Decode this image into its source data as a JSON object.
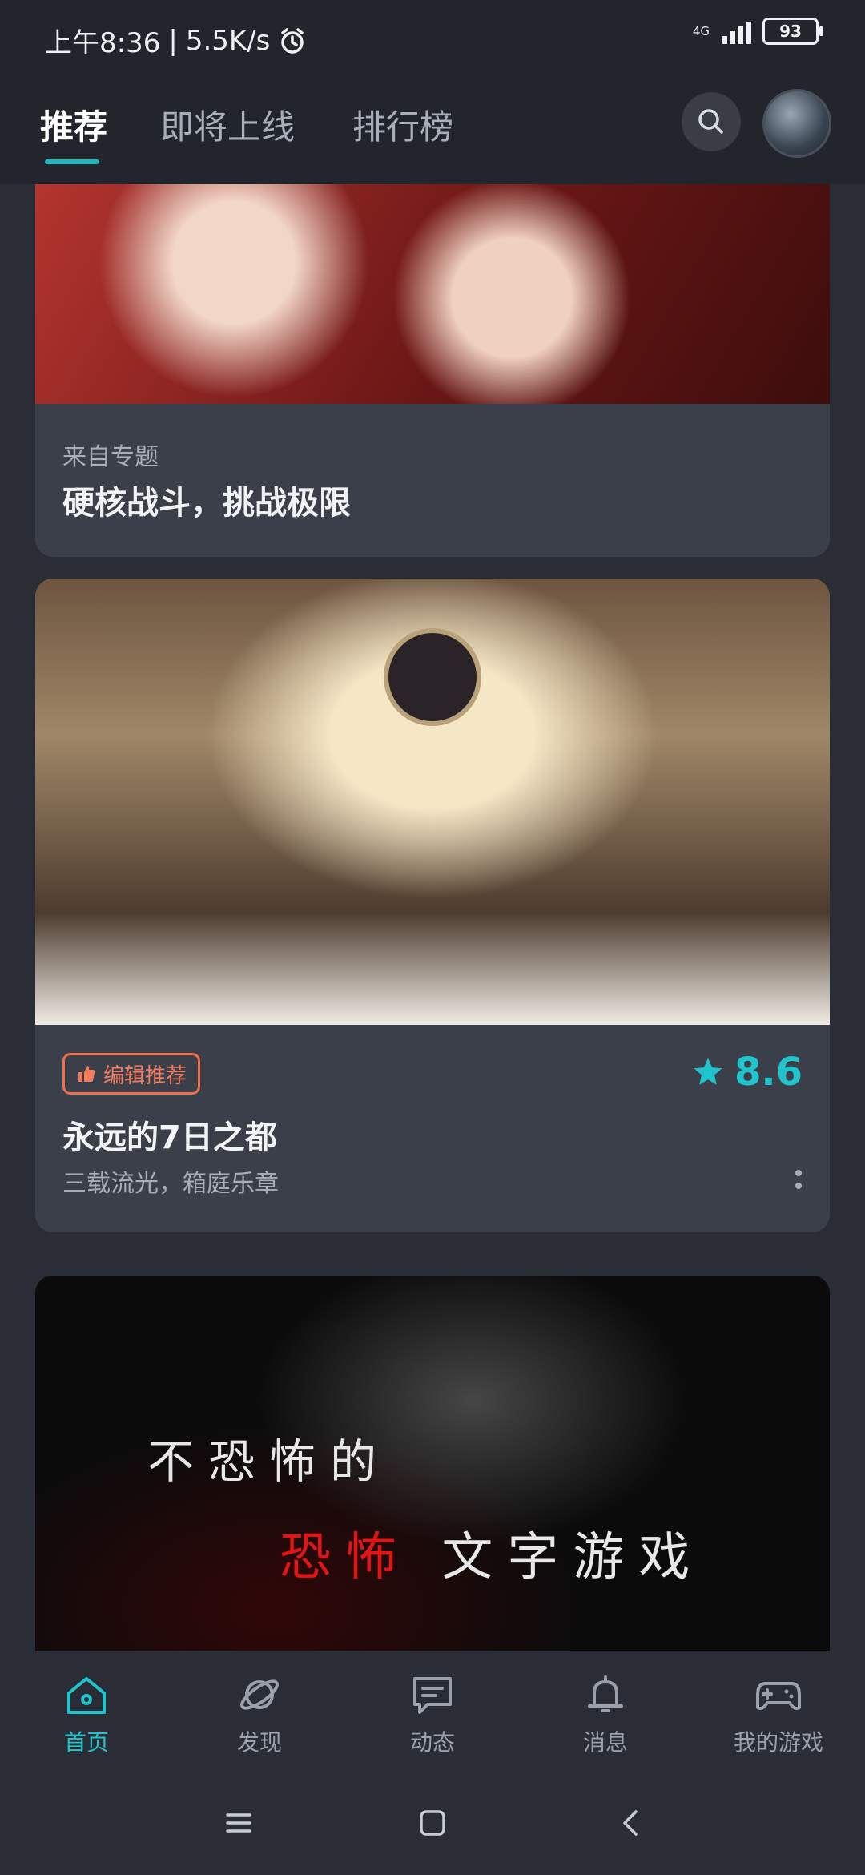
{
  "status_bar": {
    "time": "上午8:36",
    "net_speed": "5.5K/s",
    "net_type": "4G",
    "battery": "93"
  },
  "top_nav": {
    "tabs": [
      "推荐",
      "即将上线",
      "排行榜"
    ],
    "active_tab_index": 0
  },
  "feed": {
    "topic_card": {
      "source_label": "来自专题",
      "title": "硬核战斗，挑战极限"
    },
    "game_card": {
      "badge": "编辑推荐",
      "rating": "8.6",
      "title": "永远的7日之都",
      "description": "三载流光，箱庭乐章"
    },
    "banner_card": {
      "line1": "不恐怖的",
      "line2_red": "恐怖",
      "line2_white": "文字游戏"
    }
  },
  "bottom_nav": {
    "items": [
      {
        "label": "首页",
        "icon": "home-icon"
      },
      {
        "label": "发现",
        "icon": "planet-icon"
      },
      {
        "label": "动态",
        "icon": "chat-icon"
      },
      {
        "label": "消息",
        "icon": "bell-icon"
      },
      {
        "label": "我的游戏",
        "icon": "gamepad-icon"
      }
    ],
    "active_index": 0
  },
  "colors": {
    "accent": "#20c4cc",
    "badge": "#f06d4e",
    "background": "#2a2d36",
    "card": "#3b3f4a"
  }
}
